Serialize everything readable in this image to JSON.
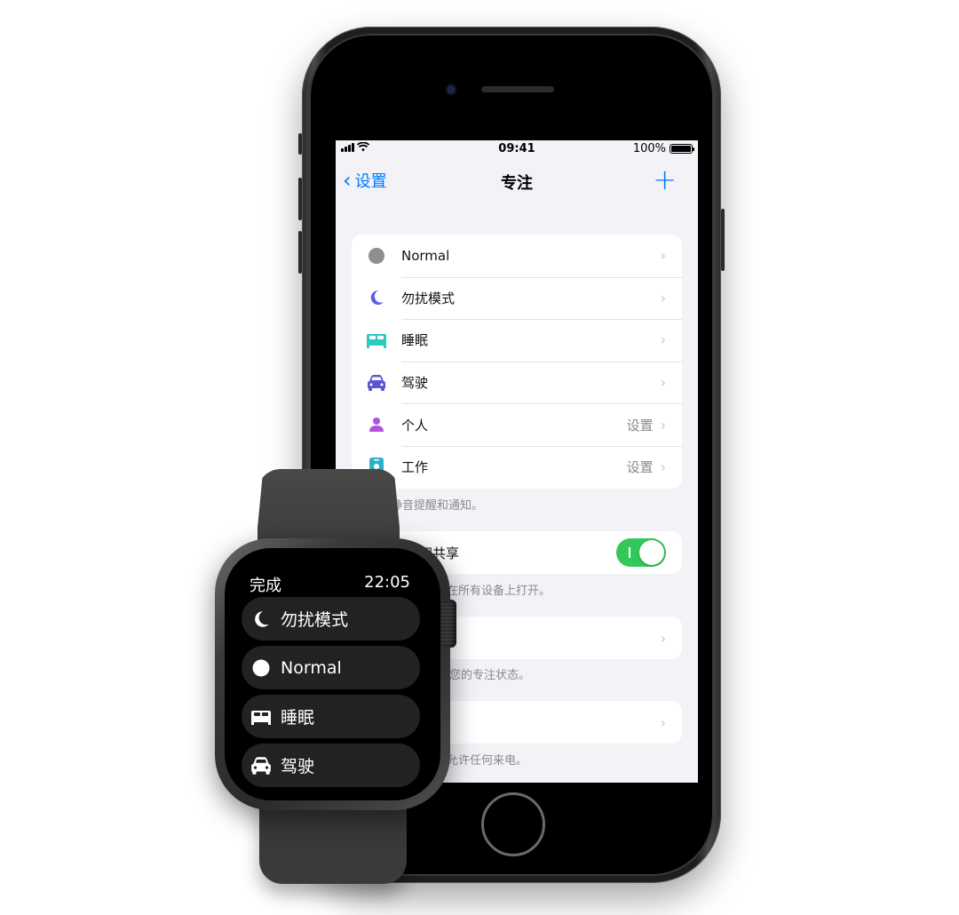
{
  "phone": {
    "status_bar": {
      "time": "09:41",
      "battery": "100%"
    },
    "nav": {
      "back_label": "设置",
      "title": "专注",
      "add_label": "+"
    },
    "focus_modes": [
      {
        "label": "Normal",
        "icon": "circle-icon",
        "color": "#8e8e93",
        "detail": ""
      },
      {
        "label": "勿扰模式",
        "icon": "moon-icon",
        "color": "#5e5ce6",
        "detail": ""
      },
      {
        "label": "睡眠",
        "icon": "bed-icon",
        "color": "#30c9c2",
        "detail": ""
      },
      {
        "label": "驾驶",
        "icon": "car-icon",
        "color": "#5856d6",
        "detail": ""
      },
      {
        "label": "个人",
        "icon": "person-icon",
        "color": "#af52de",
        "detail": "设置"
      },
      {
        "label": "工作",
        "icon": "id-badge-icon",
        "color": "#30b0c7",
        "detail": "设置"
      }
    ],
    "modes_footer": "式会静音提醒和通知。",
    "share_row": {
      "label": "间共享",
      "toggle_on": true
    },
    "share_footer": "将在所有设备上打开。",
    "status_footer": "访问您的专注状态。",
    "calls_footer": "不允许任何来电。"
  },
  "watch": {
    "done_label": "完成",
    "time": "22:05",
    "items": [
      {
        "label": "勿扰模式",
        "icon": "moon-icon"
      },
      {
        "label": "Normal",
        "icon": "circle-icon"
      },
      {
        "label": "睡眠",
        "icon": "bed-icon"
      },
      {
        "label": "驾驶",
        "icon": "car-icon"
      }
    ]
  }
}
